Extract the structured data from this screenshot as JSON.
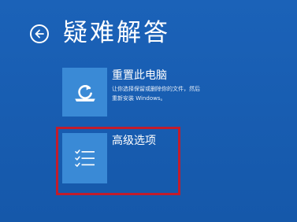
{
  "header": {
    "title": "疑难解答",
    "back_icon": "back-arrow-icon"
  },
  "options": {
    "reset": {
      "title": "重置此电脑",
      "desc_line1": "让你选择保留或删除你的文件，然后",
      "desc_line2": "重新安装 Windows。",
      "icon": "refresh-icon"
    },
    "advanced": {
      "title": "高级选项",
      "icon": "checklist-icon"
    }
  },
  "colors": {
    "background": "#1a5fb4",
    "tile": "#3a8ad6",
    "highlight": "#c21c2c",
    "text": "#ffffff"
  }
}
